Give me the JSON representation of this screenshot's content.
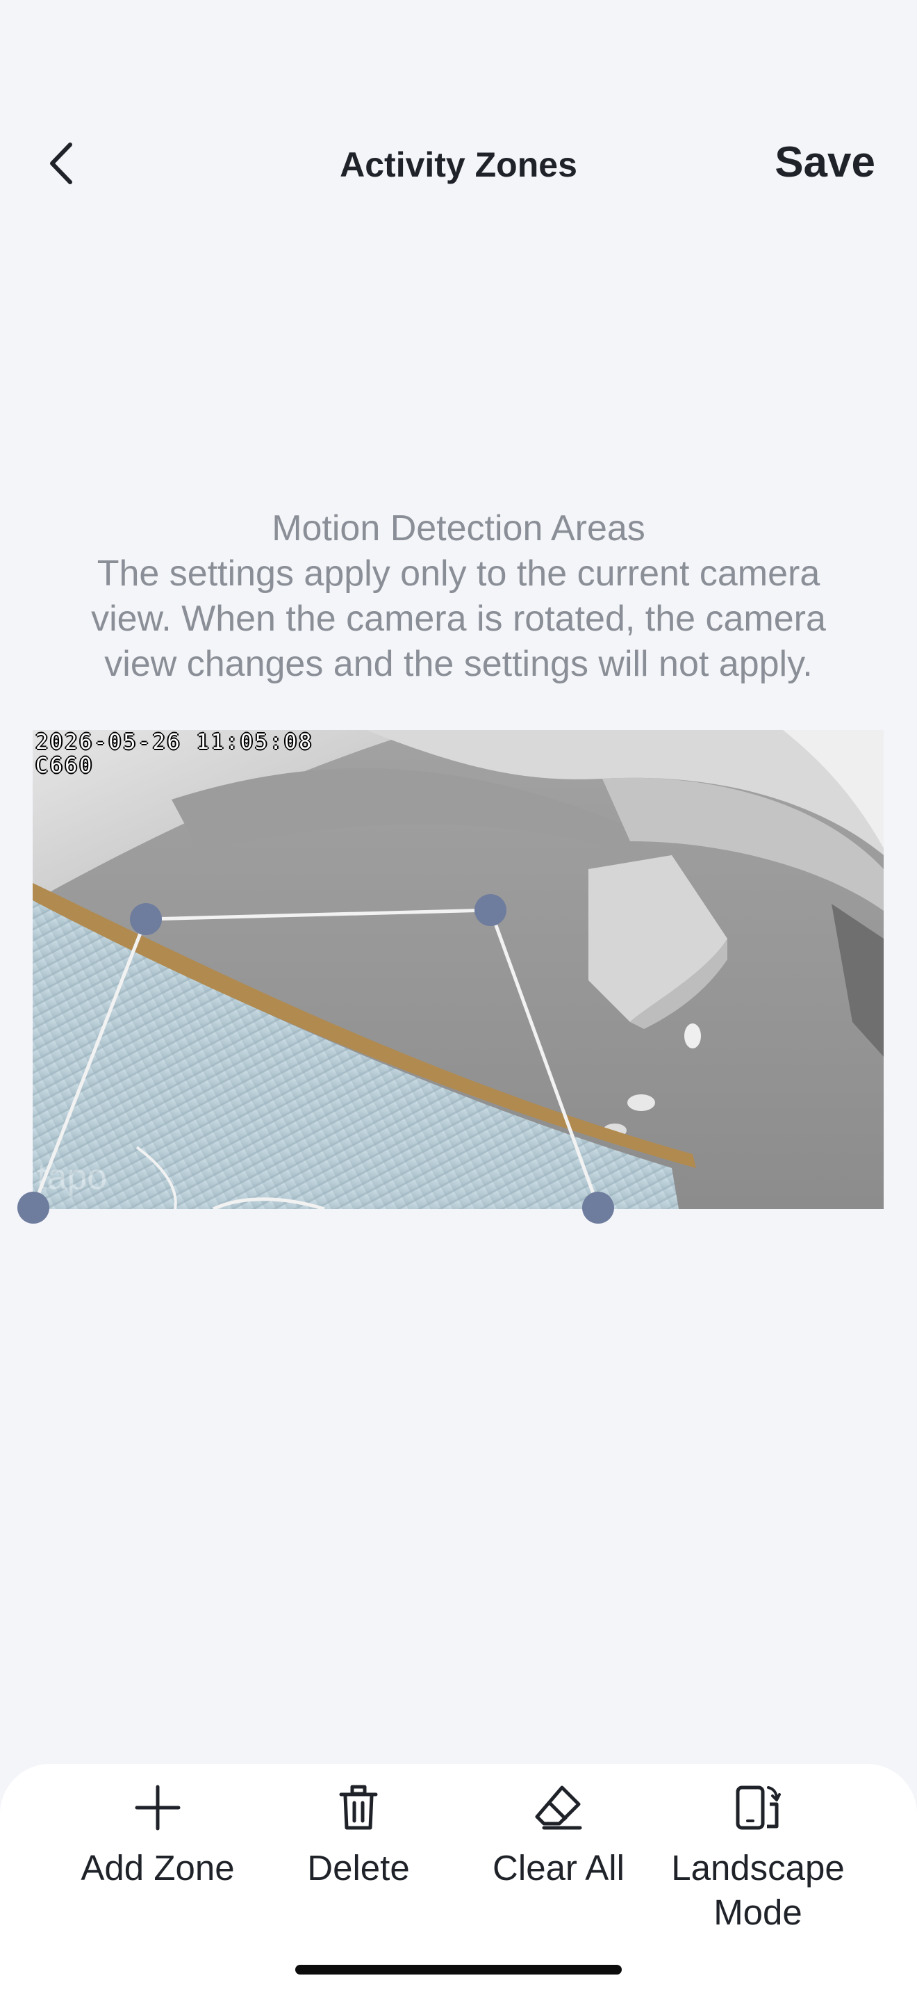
{
  "header": {
    "back_icon": "chevron-left-icon",
    "title": "Activity Zones",
    "save_label": "Save"
  },
  "description": {
    "heading": "Motion Detection Areas",
    "line1": "The settings apply only to the current camera",
    "line2": "view. When the camera is rotated, the camera",
    "line3": "view changes and the settings will not apply."
  },
  "camera": {
    "timestamp": "2026-05-26 11:05:08",
    "model": "C660",
    "watermark": "tapo"
  },
  "toolbar": {
    "add_zone": {
      "label": "Add Zone",
      "icon": "plus-icon"
    },
    "delete": {
      "label": "Delete",
      "icon": "trash-icon"
    },
    "clear_all": {
      "label": "Clear All",
      "icon": "eraser-icon"
    },
    "landscape": {
      "label_line1": "Landscape",
      "label_line2": "Mode",
      "icon": "rotate-device-icon"
    }
  },
  "colors": {
    "background": "#f4f5f9",
    "handle": "#6e7c9e",
    "zone_line": "#ffffff",
    "text_primary": "#1f2329",
    "text_secondary": "#8a8e96"
  }
}
